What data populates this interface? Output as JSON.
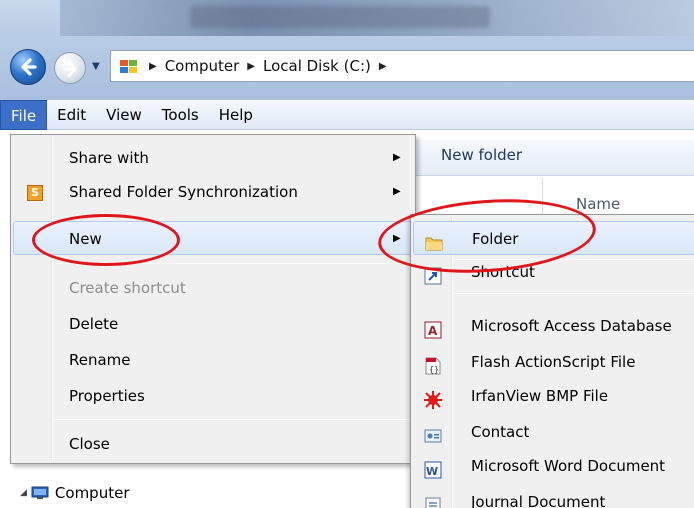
{
  "address": {
    "breadcrumbs": [
      "Computer",
      "Local Disk (C:)"
    ]
  },
  "menubar": {
    "items": [
      "File",
      "Edit",
      "View",
      "Tools",
      "Help"
    ]
  },
  "toolbar": {
    "new_folder": "New folder"
  },
  "columns": {
    "name": "Name"
  },
  "tree": {
    "computer": "Computer"
  },
  "file_menu": {
    "share_with": "Share with",
    "shared_folder_sync": "Shared Folder Synchronization",
    "new": "New",
    "create_shortcut": "Create shortcut",
    "delete": "Delete",
    "rename": "Rename",
    "properties": "Properties",
    "close": "Close"
  },
  "new_submenu": {
    "items": [
      {
        "label": "Folder",
        "icon": "folder-icon"
      },
      {
        "label": "Shortcut",
        "icon": "shortcut-icon"
      },
      {
        "label": "Microsoft Access Database",
        "icon": "access-icon"
      },
      {
        "label": "Flash ActionScript File",
        "icon": "actionscript-icon"
      },
      {
        "label": "IrfanView BMP File",
        "icon": "irfanview-icon"
      },
      {
        "label": "Contact",
        "icon": "contact-icon"
      },
      {
        "label": "Microsoft Word Document",
        "icon": "word-icon"
      },
      {
        "label": "Journal Document",
        "icon": "journal-icon"
      }
    ]
  },
  "colors": {
    "annotation": "#e0161b",
    "menu_active": "#3d6ec8",
    "highlight": "#d8e7f8"
  }
}
